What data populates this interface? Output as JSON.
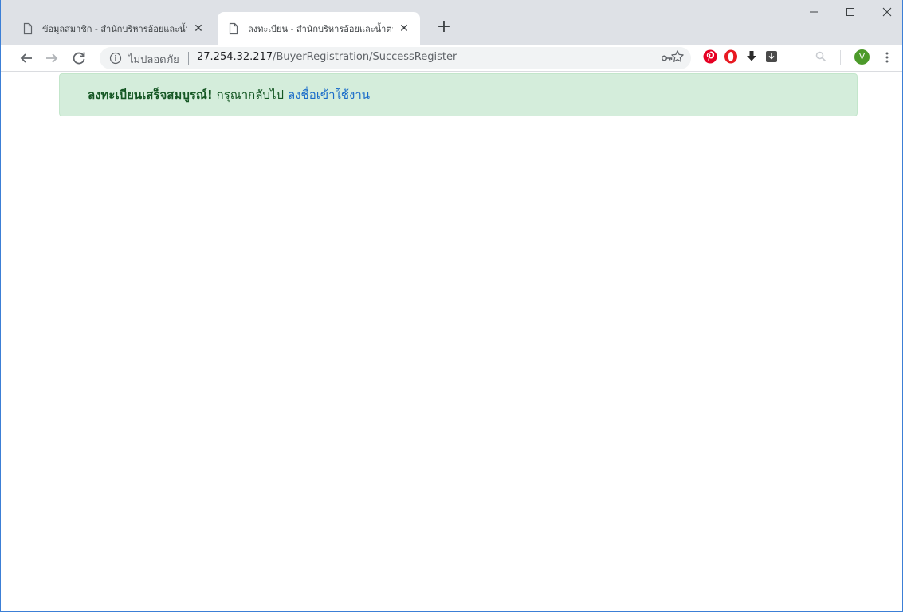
{
  "tabs": [
    {
      "title": "ข้อมูลสมาชิก - สำนักบริหารอ้อยและน้ำ",
      "close": "✕",
      "active": false
    },
    {
      "title": "ลงทะเบียน - สำนักบริหารอ้อยและน้ำตา",
      "close": "✕",
      "active": true
    }
  ],
  "new_tab_label": "+",
  "address_bar": {
    "secure_label": "ไม่ปลอดภัย",
    "url_host": "27.254.32.217",
    "url_path": "/BuyerRegistration/SuccessRegister"
  },
  "profile": {
    "initial": "V",
    "color": "#4c9a2a"
  },
  "alert": {
    "strong_text": "ลงทะเบียนเสร็จสมบูรณ์!",
    "text": "กรุณากลับไป",
    "link_text": "ลงชื่อเข้าใช้งาน"
  },
  "colors": {
    "alert_bg": "#d4eddb",
    "alert_text": "#155724",
    "link": "#1a6cc9",
    "tabstrip": "#dee1e6"
  },
  "icons": [
    "document-icon",
    "close-icon",
    "plus-icon",
    "minimize-icon",
    "maximize-icon",
    "window-close-icon",
    "back-arrow-icon",
    "forward-arrow-icon",
    "reload-icon",
    "info-icon",
    "key-icon",
    "star-icon",
    "pinterest-icon",
    "opera-icon",
    "download-icon",
    "extension-icon",
    "search-extension-icon",
    "kebab-menu-icon"
  ]
}
